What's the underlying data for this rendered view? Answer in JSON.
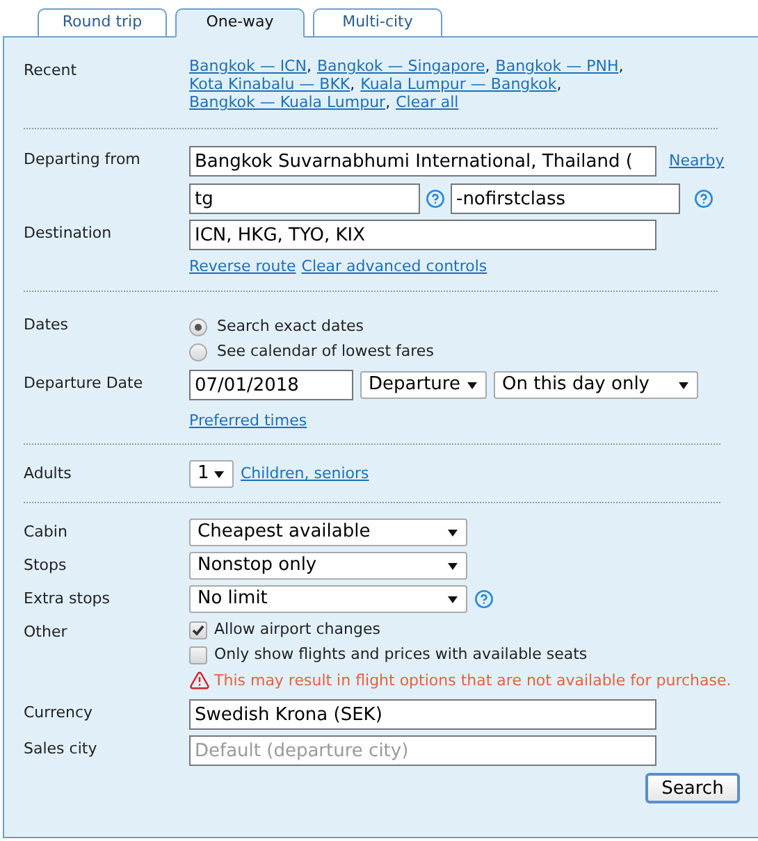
{
  "tabs": [
    {
      "label": "Round trip",
      "selected": false
    },
    {
      "label": "One-way",
      "selected": true
    },
    {
      "label": "Multi-city",
      "selected": false
    }
  ],
  "recent": {
    "label": "Recent",
    "links": [
      {
        "text": "Bangkok — ICN",
        "separator": ","
      },
      {
        "text": "Bangkok — Singapore",
        "separator": ","
      },
      {
        "text": "Bangkok — PNH",
        "separator": ","
      },
      {
        "text": "Kota Kinabalu — BKK",
        "separator": ","
      },
      {
        "text": "Kuala Lumpur — Bangkok",
        "separator": ","
      },
      {
        "text": "Bangkok — Kuala Lumpur",
        "separator": ","
      },
      {
        "text": "Clear all"
      }
    ]
  },
  "departing": {
    "label": "Departing from",
    "value": "Bangkok Suvarnabhumi International, Thailand (",
    "nearby": "Nearby",
    "airline": "tg",
    "extra": "-nofirstclass"
  },
  "destination": {
    "label": "Destination",
    "value": "ICN, HKG, TYO, KIX",
    "links": [
      "Reverse route",
      "Clear advanced controls"
    ]
  },
  "dates": {
    "label": "Dates",
    "options": [
      {
        "label": "Search exact dates",
        "selected": true
      },
      {
        "label": "See calendar of lowest fares",
        "selected": false
      }
    ]
  },
  "departure_date": {
    "label": "Departure Date",
    "value": "07/01/2018",
    "type_select": "Departure",
    "range_select": "On this day only",
    "link": "Preferred times"
  },
  "adults": {
    "label": "Adults",
    "value": "1",
    "link": "Children, seniors"
  },
  "cabin": {
    "label": "Cabin",
    "value": "Cheapest available"
  },
  "stops": {
    "label": "Stops",
    "value": "Nonstop only"
  },
  "extra_stops": {
    "label": "Extra stops",
    "value": "No limit"
  },
  "other": {
    "label": "Other",
    "options": [
      {
        "label": "Allow airport changes",
        "checked": true
      },
      {
        "label": "Only show flights and prices with available seats",
        "checked": false
      }
    ],
    "warning": "This may result in flight options that are not available for purchase."
  },
  "currency": {
    "label": "Currency",
    "value": "Swedish Krona (SEK)"
  },
  "sales_city": {
    "label": "Sales city",
    "placeholder": "Default (departure city)"
  },
  "search_button": "Search"
}
